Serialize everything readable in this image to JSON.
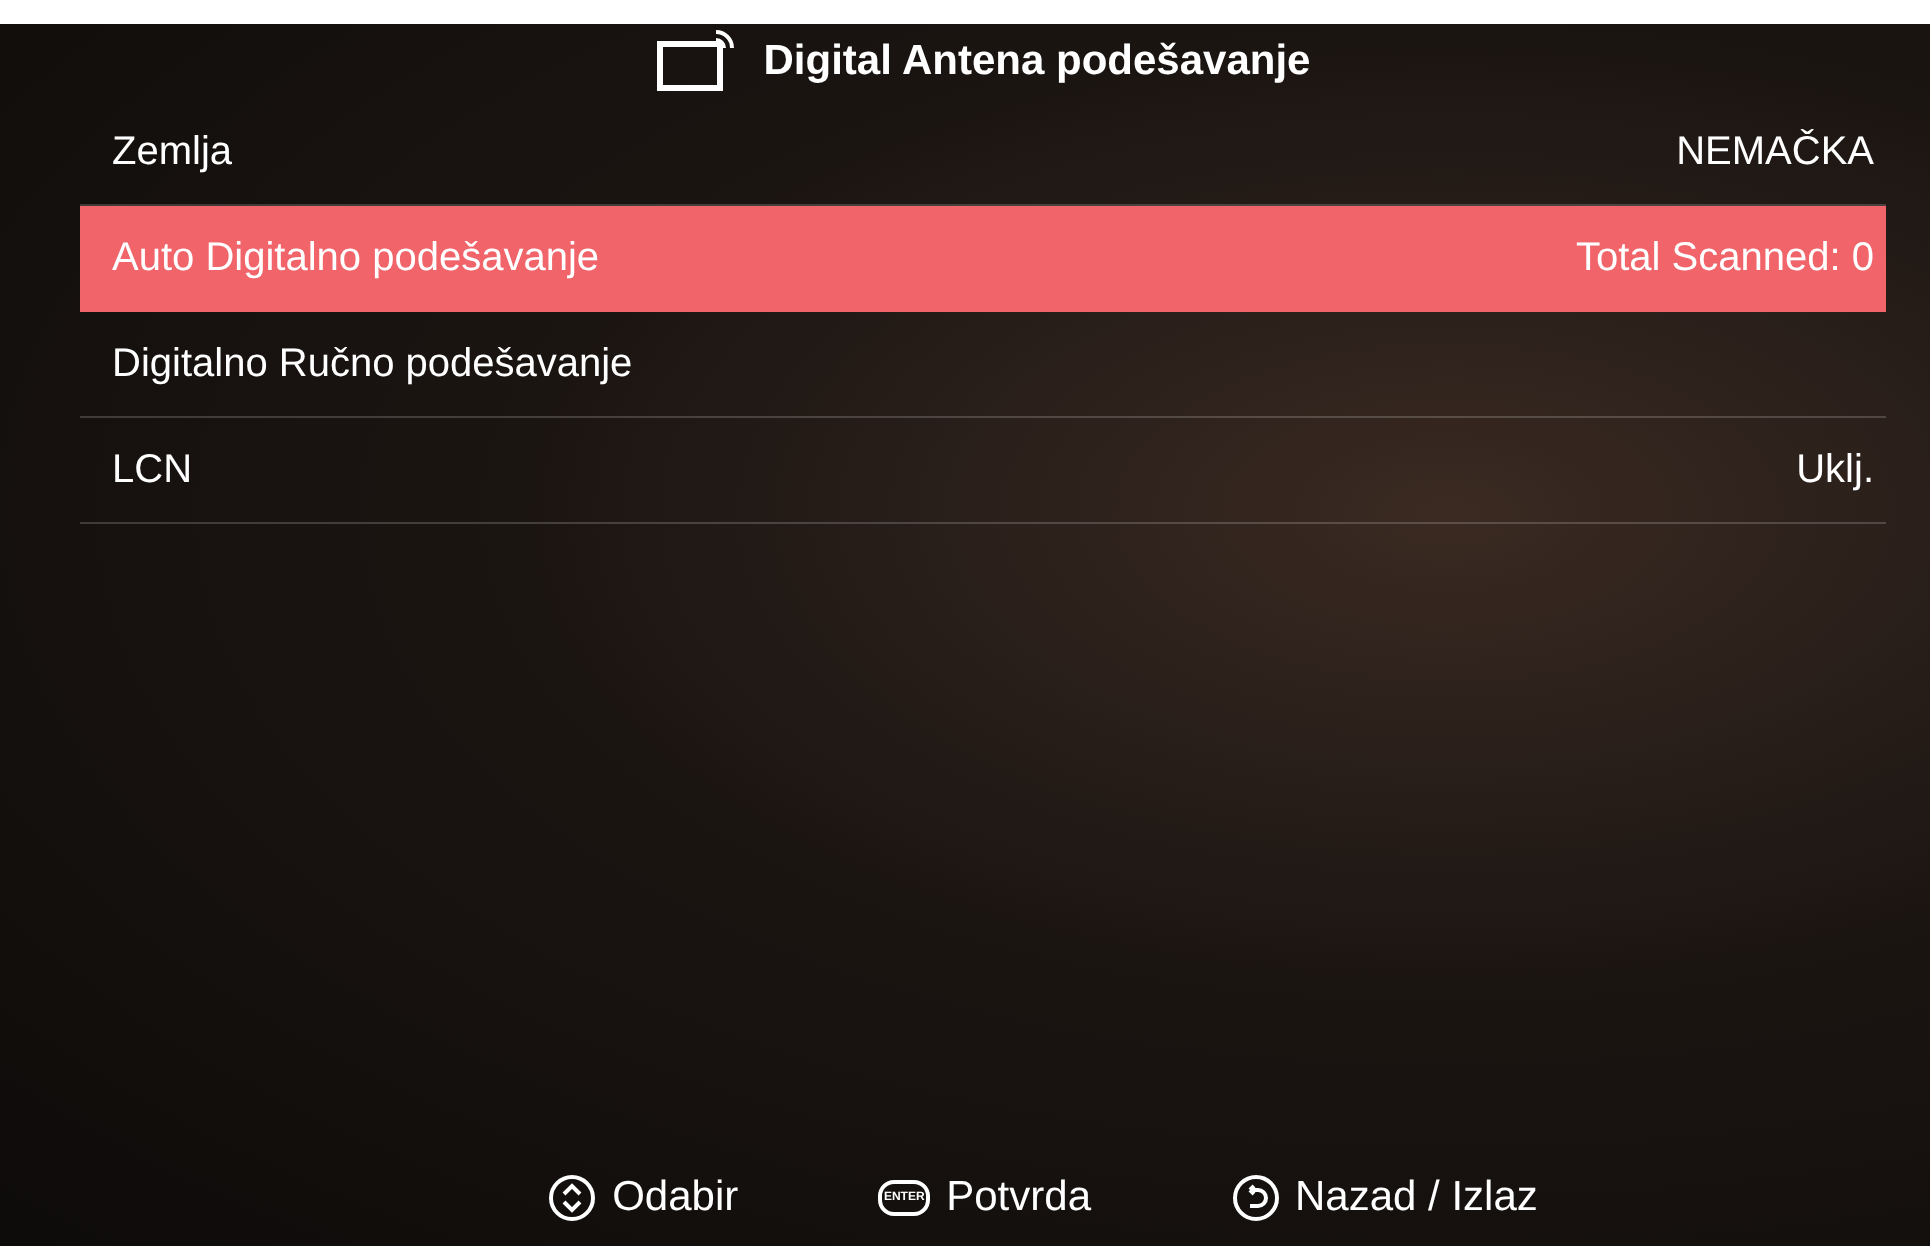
{
  "header": {
    "title": "Digital Antena podešavanje"
  },
  "rows": [
    {
      "label": "Zemlja",
      "value": "NEMAČKA",
      "selected": false
    },
    {
      "label": "Auto Digitalno podešavanje",
      "value": "Total Scanned: 0",
      "selected": true
    },
    {
      "label": "Digitalno Ručno podešavanje",
      "selected": false
    },
    {
      "label": "LCN",
      "value": "Uklj.",
      "selected": false
    }
  ],
  "footer": [
    {
      "kind": "updown",
      "label": "Odabir"
    },
    {
      "kind": "enter",
      "label": "Potvrda",
      "icon_text": "ENTER"
    },
    {
      "kind": "back",
      "label": "Nazad / Izlaz"
    }
  ]
}
